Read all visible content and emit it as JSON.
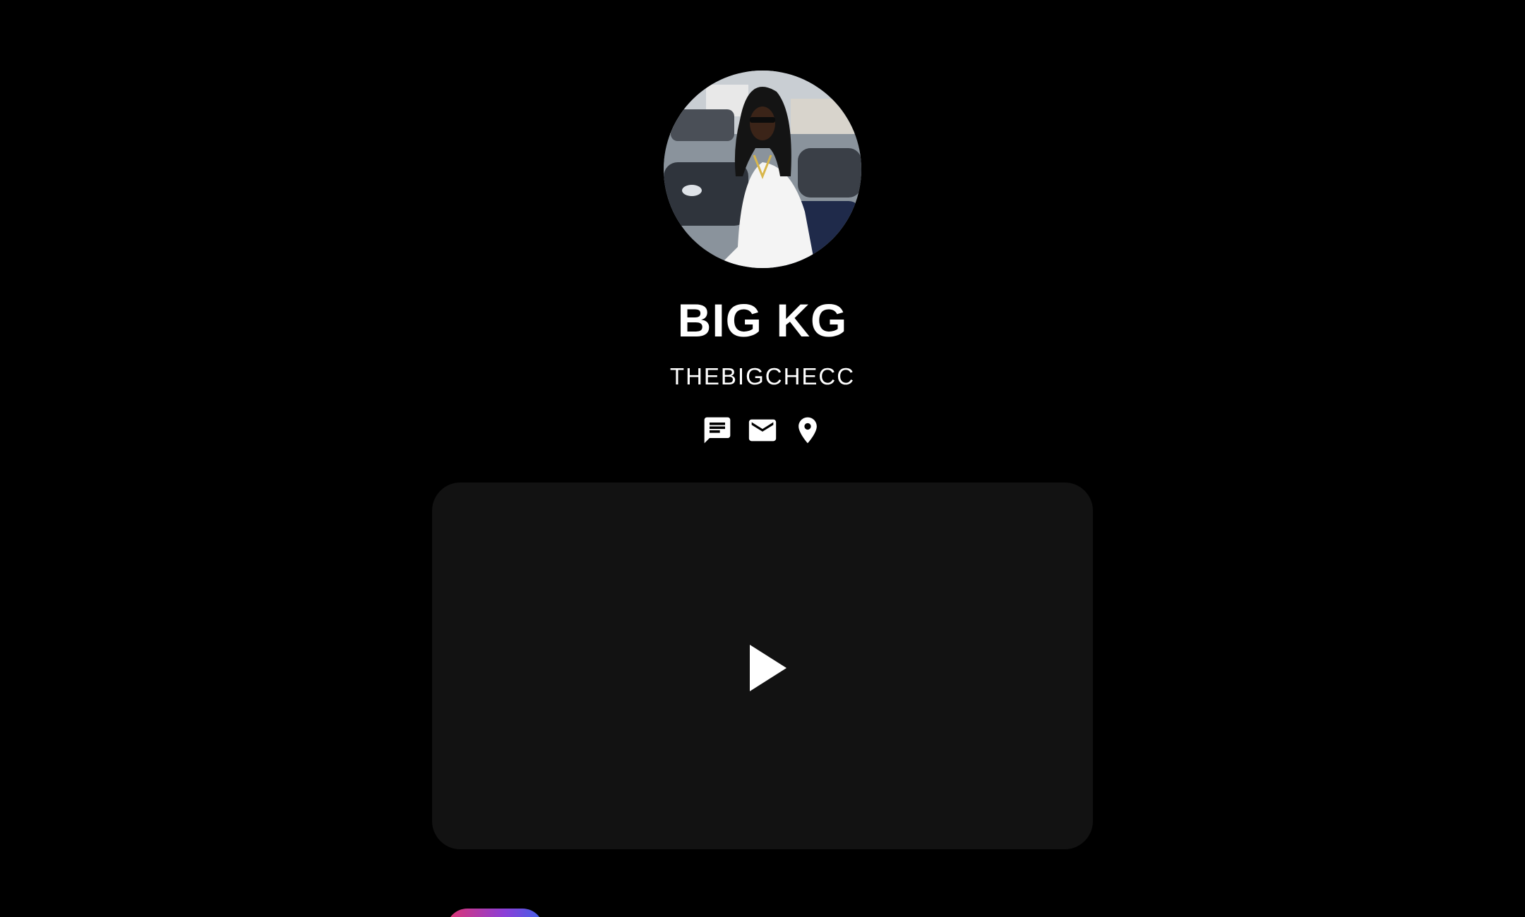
{
  "profile": {
    "display_name": "BIG KG",
    "username": "THEBIGCHECC",
    "avatar_icon": "profile-photo"
  },
  "contact": {
    "icons": [
      "sms-icon",
      "email-icon",
      "location-icon"
    ]
  },
  "video": {
    "icon": "play-icon",
    "card_color": "#121212"
  },
  "colors": {
    "background": "#000000",
    "text": "#ffffff",
    "accent_gradient": [
      "#e0356f",
      "#8c3fd8",
      "#3f63e8"
    ]
  }
}
